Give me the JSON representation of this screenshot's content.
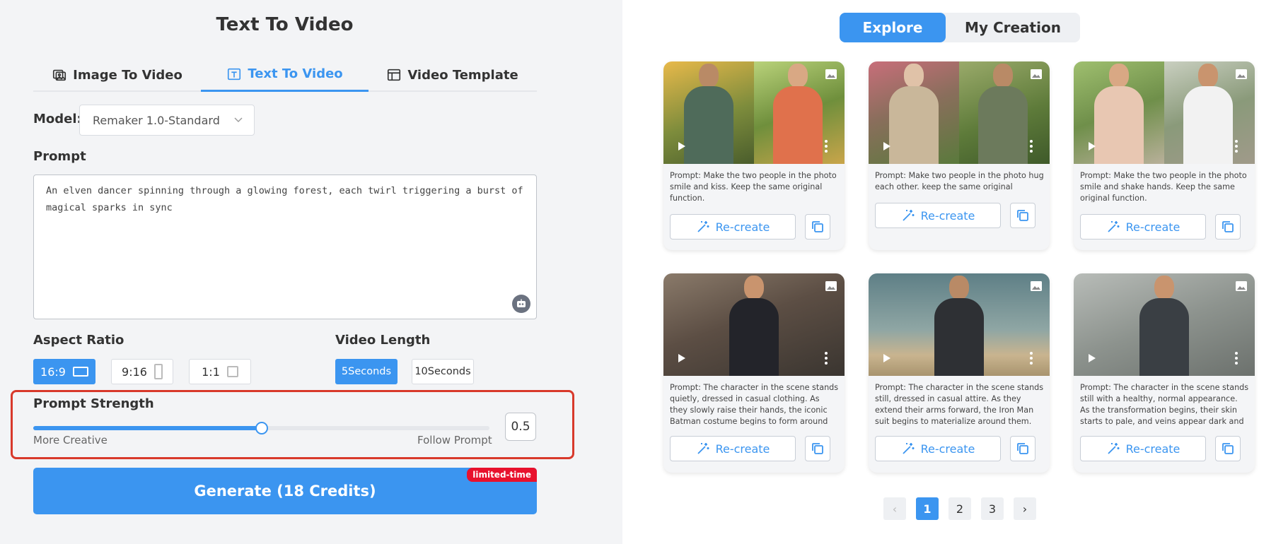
{
  "left": {
    "title": "Text To Video",
    "tabs": [
      {
        "label": "Image To Video",
        "icon": "image-video-icon"
      },
      {
        "label": "Text To Video",
        "icon": "text-icon"
      },
      {
        "label": "Video Template",
        "icon": "template-icon"
      }
    ],
    "active_tab": "Text To Video",
    "model": {
      "label": "Model:",
      "value": "Remaker 1.0-Standard"
    },
    "prompt": {
      "label": "Prompt",
      "value": "An elven dancer spinning through a glowing forest, each twirl triggering a burst of magical sparks in sync"
    },
    "aspect": {
      "label": "Aspect Ratio",
      "options": [
        "16:9",
        "9:16",
        "1:1"
      ],
      "selected": "16:9"
    },
    "length": {
      "label": "Video Length",
      "options": [
        "5Seconds",
        "10Seconds"
      ],
      "selected": "5Seconds"
    },
    "strength": {
      "label": "Prompt Strength",
      "left": "More Creative",
      "right": "Follow Prompt",
      "value": "0.5",
      "fraction": 0.5
    },
    "generate": {
      "label": "Generate (18 Credits)",
      "badge": "limited-time"
    }
  },
  "right": {
    "tabs": [
      "Explore",
      "My Creation"
    ],
    "active_tab": "Explore",
    "cards": [
      {
        "prompt": "Prompt: Make the two people in the photo smile and kiss. Keep the same original function.",
        "button": "Re-create"
      },
      {
        "prompt": "Prompt: Make two people in the photo hug each other. keep the same original features.",
        "button": "Re-create"
      },
      {
        "prompt": "Prompt: Make the two people in the photo smile and shake hands. Keep the same original function.",
        "button": "Re-create"
      },
      {
        "prompt": "Prompt: The character in the scene stands quietly, dressed in casual clothing. As they slowly raise their hands, the iconic Batman costume begins to form around their body. The...",
        "button": "Re-create"
      },
      {
        "prompt": "Prompt: The character in the scene stands still, dressed in casual attire. As they extend their arms forward, the Iron Man suit begins to materialize around them. The transformation...",
        "button": "Re-create"
      },
      {
        "prompt": "Prompt: The character in the scene stands still with a healthy, normal appearance. As the transformation begins, their skin starts to pale, and veins appear dark and prominent...",
        "button": "Re-create"
      }
    ],
    "pagination": {
      "prev": "‹",
      "pages": [
        "1",
        "2",
        "3"
      ],
      "current": "1",
      "next": "›"
    }
  },
  "colors": {
    "accent": "#3b95f0",
    "highlight": "#d8392b",
    "badge": "#e8112d"
  }
}
